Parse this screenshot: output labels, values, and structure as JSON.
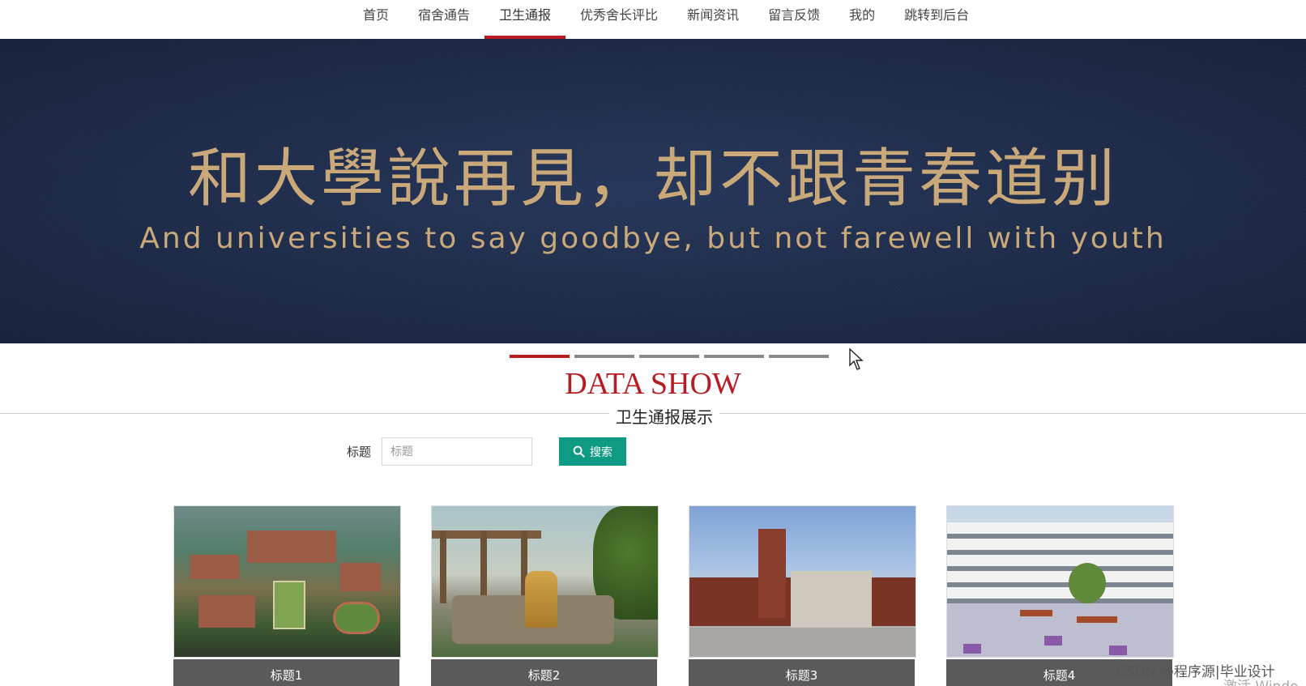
{
  "nav": {
    "items": [
      {
        "label": "首页",
        "active": false
      },
      {
        "label": "宿舍通告",
        "active": false
      },
      {
        "label": "卫生通报",
        "active": true
      },
      {
        "label": "优秀舍长评比",
        "active": false
      },
      {
        "label": "新闻资讯",
        "active": false
      },
      {
        "label": "留言反馈",
        "active": false
      },
      {
        "label": "我的",
        "active": false
      },
      {
        "label": "跳转到后台",
        "active": false
      }
    ],
    "active_color": "#b81c22"
  },
  "banner": {
    "title": "和大學說再見，却不跟青春道别",
    "subtitle": "And universities to say goodbye, but not farewell with youth",
    "text_color": "#c9a97a",
    "slide_count": 5,
    "active_slide": 1
  },
  "section": {
    "title": "DATA SHOW",
    "subtitle": "卫生通报展示",
    "title_color": "#b81c22"
  },
  "search": {
    "label": "标题",
    "placeholder": "标题",
    "value": "",
    "button_label": "搜索",
    "button_color": "#0f9b83",
    "button_icon": "search-icon"
  },
  "cards": [
    {
      "caption": "标题1"
    },
    {
      "caption": "标题2"
    },
    {
      "caption": "标题3"
    },
    {
      "caption": "标题4"
    }
  ],
  "watermark": {
    "text": "CSDN @程序源|毕业设计",
    "os_text": "激活 Windo"
  }
}
